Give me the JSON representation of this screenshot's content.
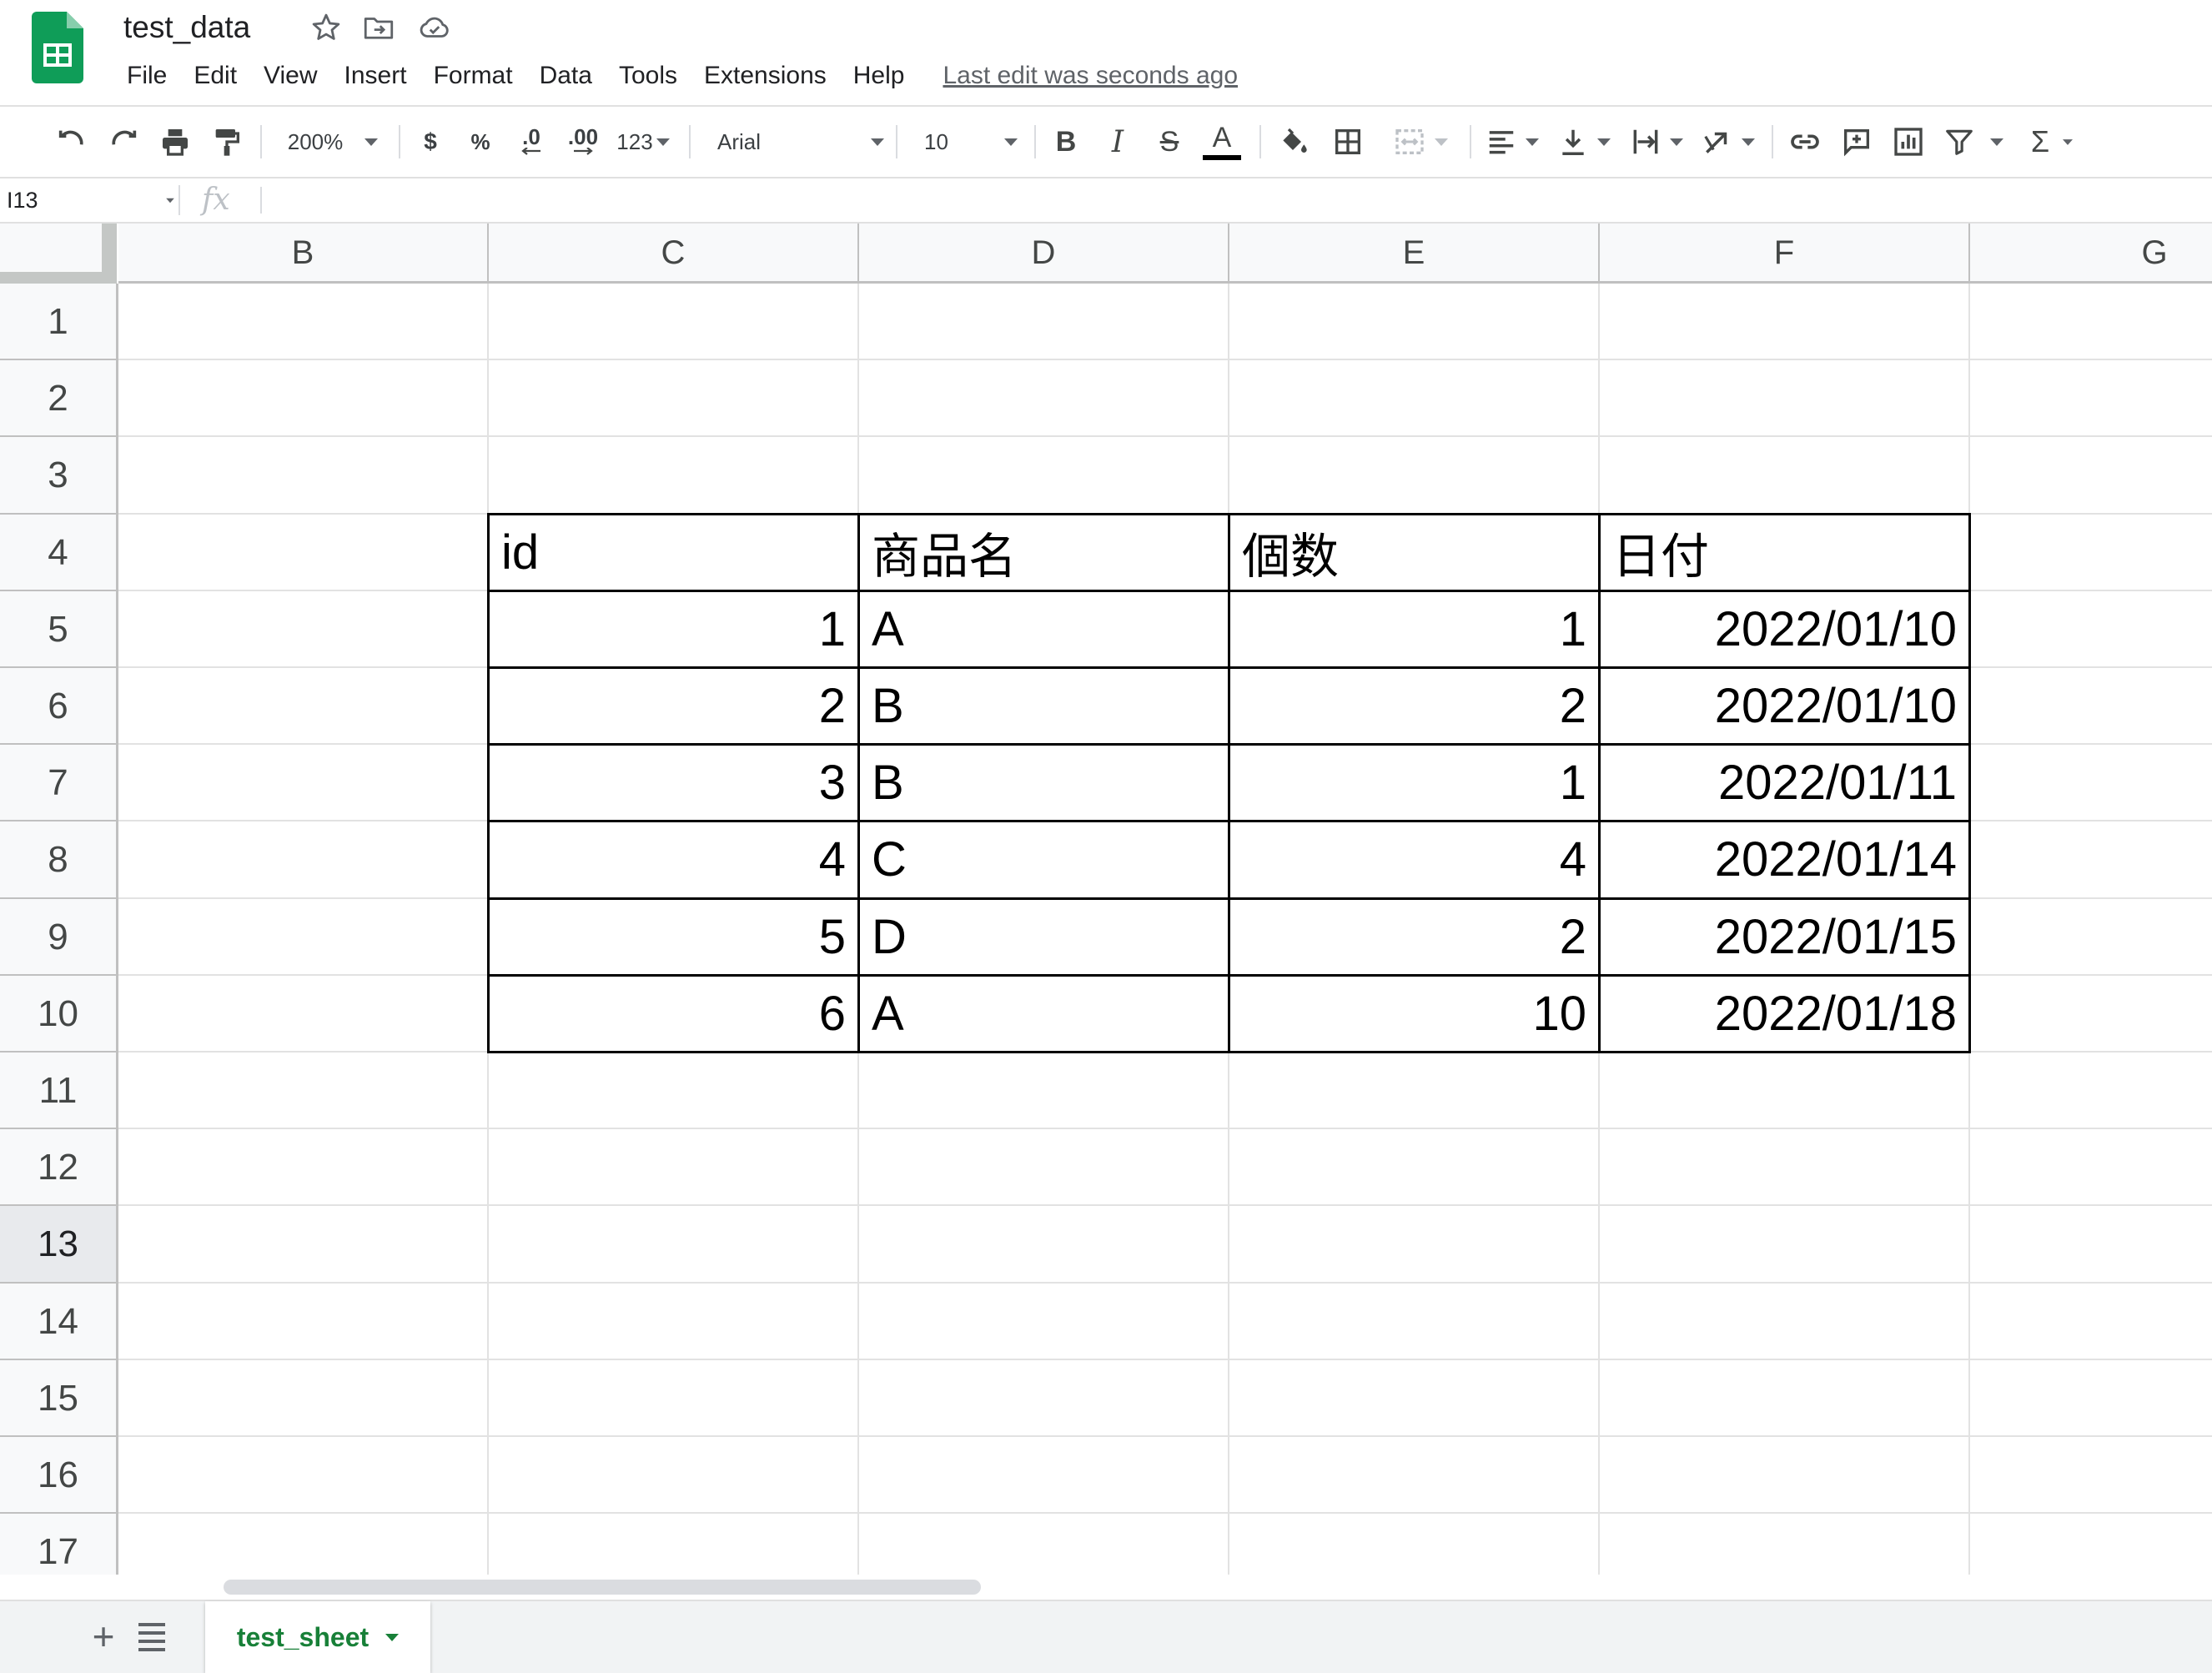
{
  "app": {
    "doc_title": "test_data",
    "menus": [
      "File",
      "Edit",
      "View",
      "Insert",
      "Format",
      "Data",
      "Tools",
      "Extensions",
      "Help"
    ],
    "last_edit": "Last edit was seconds ago",
    "brand_color": "#0f9d58"
  },
  "toolbar": {
    "zoom": "200%",
    "currency": "$",
    "percent": "%",
    "decrease_decimal": ".0",
    "increase_decimal": ".00",
    "more_formats": "123",
    "font": "Arial",
    "font_size": "10",
    "bold": "B",
    "italic": "I",
    "strikethrough": "S",
    "text_color": "A",
    "sum": "Σ"
  },
  "formula_bar": {
    "name_box": "I13",
    "fx": "fx",
    "value": ""
  },
  "grid": {
    "columns": [
      "B",
      "C",
      "D",
      "E",
      "F",
      "G"
    ],
    "rows": [
      "1",
      "2",
      "3",
      "4",
      "5",
      "6",
      "7",
      "8",
      "9",
      "10",
      "11",
      "12",
      "13",
      "14",
      "15",
      "16",
      "17"
    ],
    "selected_row": "13"
  },
  "table": {
    "headers": [
      "id",
      "商品名",
      "個数",
      "日付"
    ],
    "rows": [
      [
        "1",
        "A",
        "1",
        "2022/01/10"
      ],
      [
        "2",
        "B",
        "2",
        "2022/01/10"
      ],
      [
        "3",
        "B",
        "1",
        "2022/01/11"
      ],
      [
        "4",
        "C",
        "4",
        "2022/01/14"
      ],
      [
        "5",
        "D",
        "2",
        "2022/01/15"
      ],
      [
        "6",
        "A",
        "10",
        "2022/01/18"
      ]
    ]
  },
  "sheets": {
    "add": "+",
    "active": "test_sheet"
  }
}
